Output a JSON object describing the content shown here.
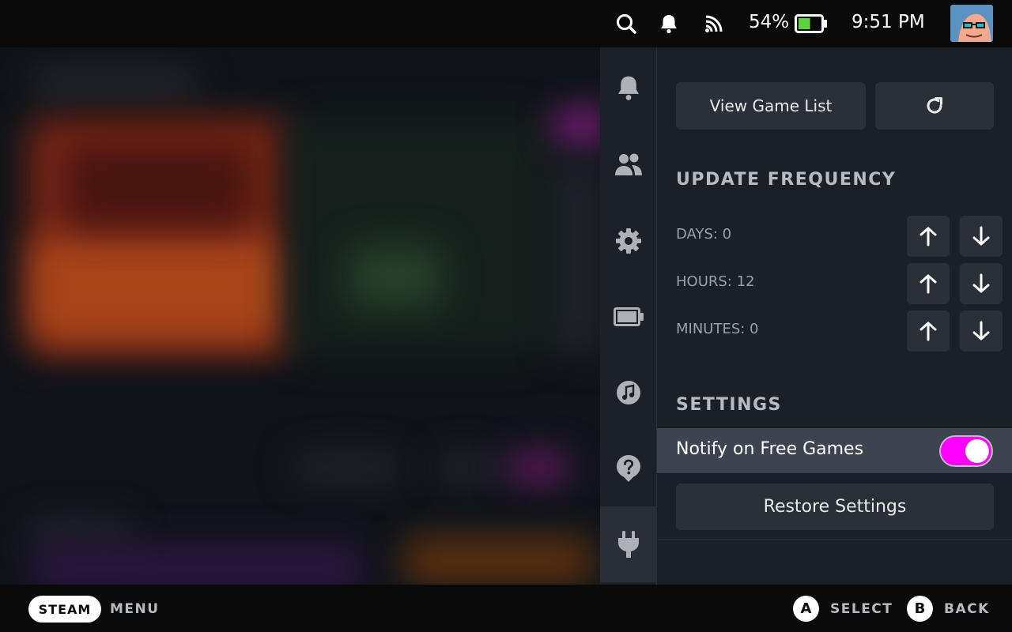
{
  "status_bar": {
    "battery_percent": "54%",
    "battery_level": 0.54,
    "time": "9:51 PM",
    "icons": [
      "search-icon",
      "bell-icon",
      "wifi-icon",
      "battery-icon"
    ]
  },
  "rail": {
    "items": [
      {
        "name": "notifications",
        "icon": "bell-icon"
      },
      {
        "name": "friends",
        "icon": "friends-icon"
      },
      {
        "name": "settings",
        "icon": "gear-icon"
      },
      {
        "name": "performance",
        "icon": "battery-icon"
      },
      {
        "name": "music",
        "icon": "music-note-icon"
      },
      {
        "name": "help",
        "icon": "help-icon"
      },
      {
        "name": "plugins",
        "icon": "plug-icon",
        "active": true
      }
    ]
  },
  "panel": {
    "view_game_list": "View Game List",
    "update_frequency": {
      "title": "UPDATE FREQUENCY",
      "days": "DAYS: 0",
      "hours": "HOURS: 12",
      "minutes": "MINUTES: 0"
    },
    "settings": {
      "title": "SETTINGS",
      "notify_label": "Notify on Free Games",
      "notify_enabled": true,
      "restore_label": "Restore Settings"
    }
  },
  "bottom_bar": {
    "steam": "STEAM",
    "menu": "MENU",
    "a_button": "A",
    "select": "SELECT",
    "b_button": "B",
    "back": "BACK"
  },
  "colors": {
    "accent_toggle": "#ff00ff",
    "battery_fill": "#5dd23e",
    "panel_bg": "#1b1f26",
    "button_bg": "#2b2f37"
  }
}
